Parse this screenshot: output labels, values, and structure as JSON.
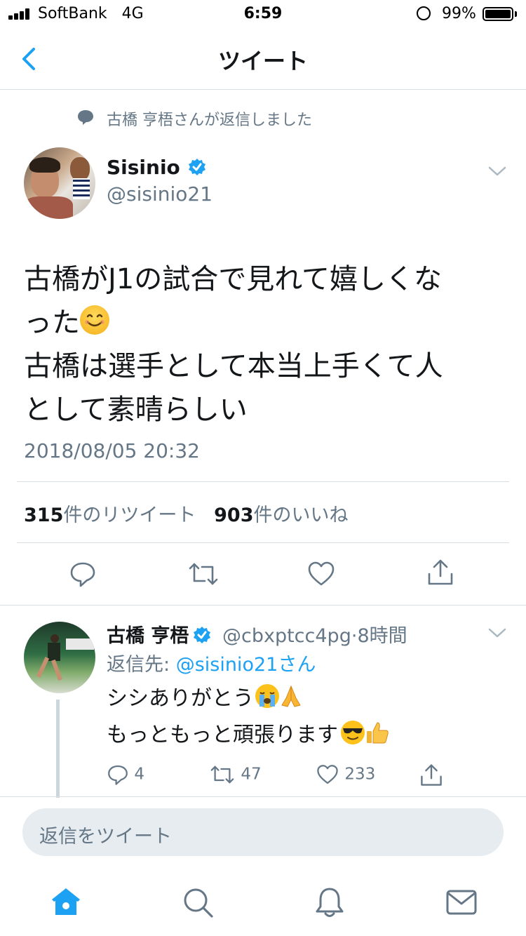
{
  "status_bar": {
    "carrier": "SoftBank",
    "network": "4G",
    "time": "6:59",
    "battery": "99%"
  },
  "nav": {
    "title": "ツイート"
  },
  "tweet": {
    "reply_note": "古橋 亨梧さんが返信しました",
    "name": "Sisinio",
    "handle": "@sisinio21",
    "text_line1": "古橋がJ1の試合で見れて嬉しくな",
    "text_line2": "った",
    "text_line3": "古橋は選手として本当上手くて人",
    "text_line4": "として素晴らしい",
    "date": "2018/08/05 20:32",
    "retweet_count": "315",
    "retweet_label": "件のリツイート",
    "like_count": "903",
    "like_label": "件のいいね"
  },
  "reply": {
    "name": "古橋 亨梧",
    "handle": "@cbxptcc4pg",
    "separator": "·",
    "time": "8時間",
    "reply_to_label": "返信先: ",
    "reply_to_handle": "@sisinio21さん",
    "text_line1": "シシありがとう",
    "text_line2": "もっともっと頑張ります",
    "reply_count": "4",
    "retweet_count": "47",
    "like_count": "233"
  },
  "compose": {
    "placeholder": "返信をツイート"
  },
  "colors": {
    "accent": "#1da1f2",
    "muted": "#657786",
    "divider": "#d8dde2",
    "text": "#14171a"
  },
  "icons": [
    "back-chevron-icon",
    "reply-bubble-icon",
    "verified-badge-icon",
    "chevron-down-icon",
    "reply-icon",
    "retweet-icon",
    "like-icon",
    "share-icon",
    "home-icon",
    "search-icon",
    "notifications-icon",
    "messages-icon"
  ]
}
